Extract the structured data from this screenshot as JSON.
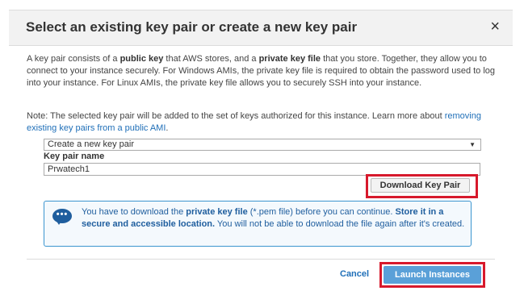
{
  "dialog": {
    "title": "Select an existing key pair or create a new key pair",
    "close_icon": "×"
  },
  "intro": {
    "p1_a": "A key pair consists of a ",
    "p1_b": "public key",
    "p1_c": " that AWS stores, and a ",
    "p1_d": "private key file",
    "p1_e": " that you store. Together, they allow you to connect to your instance securely. For Windows AMIs, the private key file is required to obtain the password used to log into your instance. For Linux AMIs, the private key file allows you to securely SSH into your instance."
  },
  "note": {
    "text": "Note: The selected key pair will be added to the set of keys authorized for this instance. Learn more about ",
    "link": "removing existing key pairs from a public AMI",
    "end": "."
  },
  "key_select": {
    "selected": "Create a new key pair",
    "arrow": "▼"
  },
  "key_name": {
    "label": "Key pair name",
    "value": "Prwatech1"
  },
  "download_button": "Download Key Pair",
  "info": {
    "t1": "You have to download the ",
    "t2": "private key file",
    "t3": " (*.pem file) before you can continue. ",
    "t4": "Store it in a secure and accessible location.",
    "t5": " You will not be able to download the file again after it's created.",
    "icon": "chat-bubble-icon"
  },
  "footer": {
    "cancel": "Cancel",
    "launch": "Launch Instances"
  },
  "colors": {
    "accent_blue": "#1f6fb8",
    "launch_button": "#5aa0d8",
    "highlight_red": "#d7192c"
  }
}
